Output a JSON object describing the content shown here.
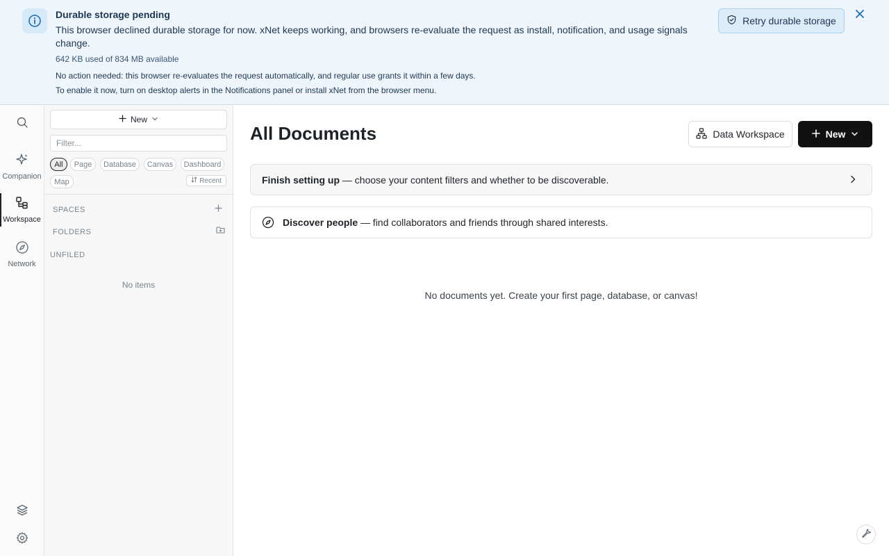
{
  "banner": {
    "title": "Durable storage pending",
    "message": "This browser declined durable storage for now. xNet keeps working, and browsers re-evaluate the request as install, notification, and usage signals change.",
    "usage": "642 KB used of 834 MB available",
    "note_1": "No action needed: this browser re-evaluates the request automatically, and regular use grants it within a few days.",
    "note_2": "To enable it now, turn on desktop alerts in the Notifications panel or install xNet from the browser menu.",
    "retry_label": "Retry durable storage",
    "accent_color": "#1e6fb4"
  },
  "rail": {
    "items": [
      {
        "label": "Companion",
        "icon": "sparkle-icon"
      },
      {
        "label": "Workspace",
        "icon": "workspace-icon",
        "active": true
      },
      {
        "label": "Network",
        "icon": "compass-icon"
      }
    ],
    "bottom_icons": [
      "layers-icon",
      "gear-icon"
    ]
  },
  "sidebar": {
    "new_label": "New",
    "filter_placeholder": "Filter...",
    "chips": [
      "All",
      "Page",
      "Database",
      "Canvas",
      "Dashboard",
      "Map"
    ],
    "active_chip": "All",
    "sort_label": "Recent",
    "sections": {
      "spaces": "SPACES",
      "folders": "FOLDERS",
      "unfiled": "UNFILED"
    },
    "empty_text": "No items"
  },
  "main": {
    "title": "All Documents",
    "data_workspace_label": "Data Workspace",
    "new_label": "New",
    "setup_card": {
      "bold": "Finish setting up",
      "text": " — choose your content filters and whether to be discoverable."
    },
    "discover_card": {
      "bold": "Discover people",
      "text": " — find collaborators and friends through shared interests."
    },
    "empty_text": "No documents yet. Create your first page, database, or canvas!"
  }
}
